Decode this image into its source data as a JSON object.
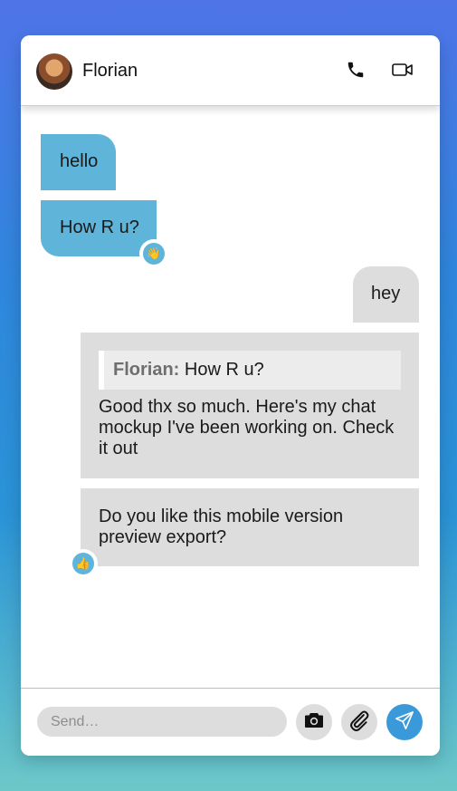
{
  "header": {
    "contact_name": "Florian",
    "avatar_icon": "profile-photo",
    "call_icon": "phone-icon",
    "video_icon": "video-camera-icon"
  },
  "messages": [
    {
      "from": "them",
      "text": "hello"
    },
    {
      "from": "them",
      "text": "How R u?",
      "reaction": "👋"
    },
    {
      "from": "me",
      "text": "hey"
    },
    {
      "from": "me",
      "quote_author": "Florian:",
      "quote_text": "How R u?",
      "text": "Good thx so much. Here's my chat mockup I've been working on. Check it out"
    },
    {
      "from": "me",
      "text": "Do you like this mobile version preview export?",
      "reaction": "👍"
    }
  ],
  "composer": {
    "placeholder": "Send…",
    "camera_icon": "camera-icon",
    "attach_icon": "paperclip-icon",
    "send_icon": "send-icon"
  },
  "colors": {
    "incoming_bubble": "#5fb4d9",
    "outgoing_bubble": "#dddddd",
    "send_button": "#3a9ad9"
  }
}
